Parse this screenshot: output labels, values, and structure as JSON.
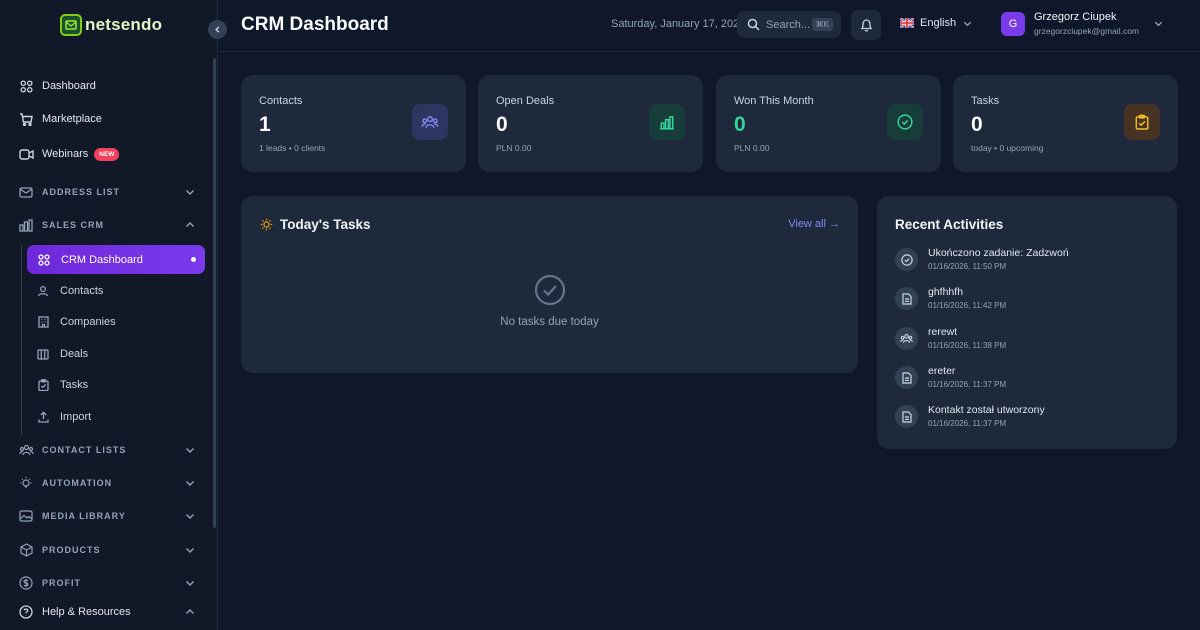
{
  "app": {
    "name": "netsendo",
    "page_title": "CRM Dashboard"
  },
  "header": {
    "date": "Saturday, January 17, 2026",
    "search_placeholder": "Search...",
    "search_shortcut": "⌘K",
    "language": "English",
    "user": {
      "initial": "G",
      "name": "Grzegorz Ciupek",
      "email": "grzegorzciupek@gmail.com"
    }
  },
  "sidebar": {
    "top_items": [
      {
        "label": "Dashboard",
        "icon": "grid-icon"
      },
      {
        "label": "Marketplace",
        "icon": "cart-icon"
      },
      {
        "label": "Webinars",
        "icon": "video-icon",
        "badge": "NEW"
      }
    ],
    "sections": [
      {
        "label": "ADDRESS LIST",
        "icon": "mail-icon",
        "expanded": false
      },
      {
        "label": "SALES CRM",
        "icon": "chart-icon",
        "expanded": true
      },
      {
        "label": "CONTACT LISTS",
        "icon": "users-icon",
        "expanded": false
      },
      {
        "label": "AUTOMATION",
        "icon": "bulb-icon",
        "expanded": false
      },
      {
        "label": "MEDIA LIBRARY",
        "icon": "image-icon",
        "expanded": false
      },
      {
        "label": "PRODUCTS",
        "icon": "box-icon",
        "expanded": false
      },
      {
        "label": "PROFIT",
        "icon": "dollar-icon",
        "expanded": false
      }
    ],
    "crm_items": [
      {
        "label": "CRM Dashboard",
        "active": true
      },
      {
        "label": "Contacts"
      },
      {
        "label": "Companies"
      },
      {
        "label": "Deals"
      },
      {
        "label": "Tasks"
      },
      {
        "label": "Import"
      }
    ],
    "help": {
      "label": "Help & Resources"
    }
  },
  "stats": [
    {
      "label": "Contacts",
      "value": "1",
      "sub": "1 leads • 0 clients",
      "icon": "users-icon",
      "color": "#818cf8",
      "bg": "#2e3560"
    },
    {
      "label": "Open Deals",
      "value": "0",
      "sub": "PLN 0.00",
      "icon": "bar-chart-icon",
      "color": "#34d399",
      "bg": "#173d3a"
    },
    {
      "label": "Won This Month",
      "value": "0",
      "sub": "PLN 0.00",
      "icon": "check-circle-icon",
      "color": "#34d399",
      "bg": "#173d3a",
      "value_color": "#34d399"
    },
    {
      "label": "Tasks",
      "value": "0",
      "sub": "today • 0 upcoming",
      "icon": "clipboard-icon",
      "color": "#fbbf24",
      "bg": "#473324"
    }
  ],
  "todays_tasks": {
    "title": "Today's Tasks",
    "view_all": "View all →",
    "empty": "No tasks due today"
  },
  "recent_activities": {
    "title": "Recent Activities",
    "items": [
      {
        "text": "Ukończono zadanie: Zadzwoń",
        "date": "01/16/2026, 11:50 PM",
        "icon": "check-circle-icon"
      },
      {
        "text": "ghfhhfh",
        "date": "01/16/2026, 11:42 PM",
        "icon": "document-icon"
      },
      {
        "text": "rerewt",
        "date": "01/16/2026, 11:38 PM",
        "icon": "users-icon"
      },
      {
        "text": "ereter",
        "date": "01/16/2026, 11:37 PM",
        "icon": "document-icon"
      },
      {
        "text": "Kontakt został utworzony",
        "date": "01/16/2026, 11:37 PM",
        "icon": "document-icon"
      }
    ]
  }
}
